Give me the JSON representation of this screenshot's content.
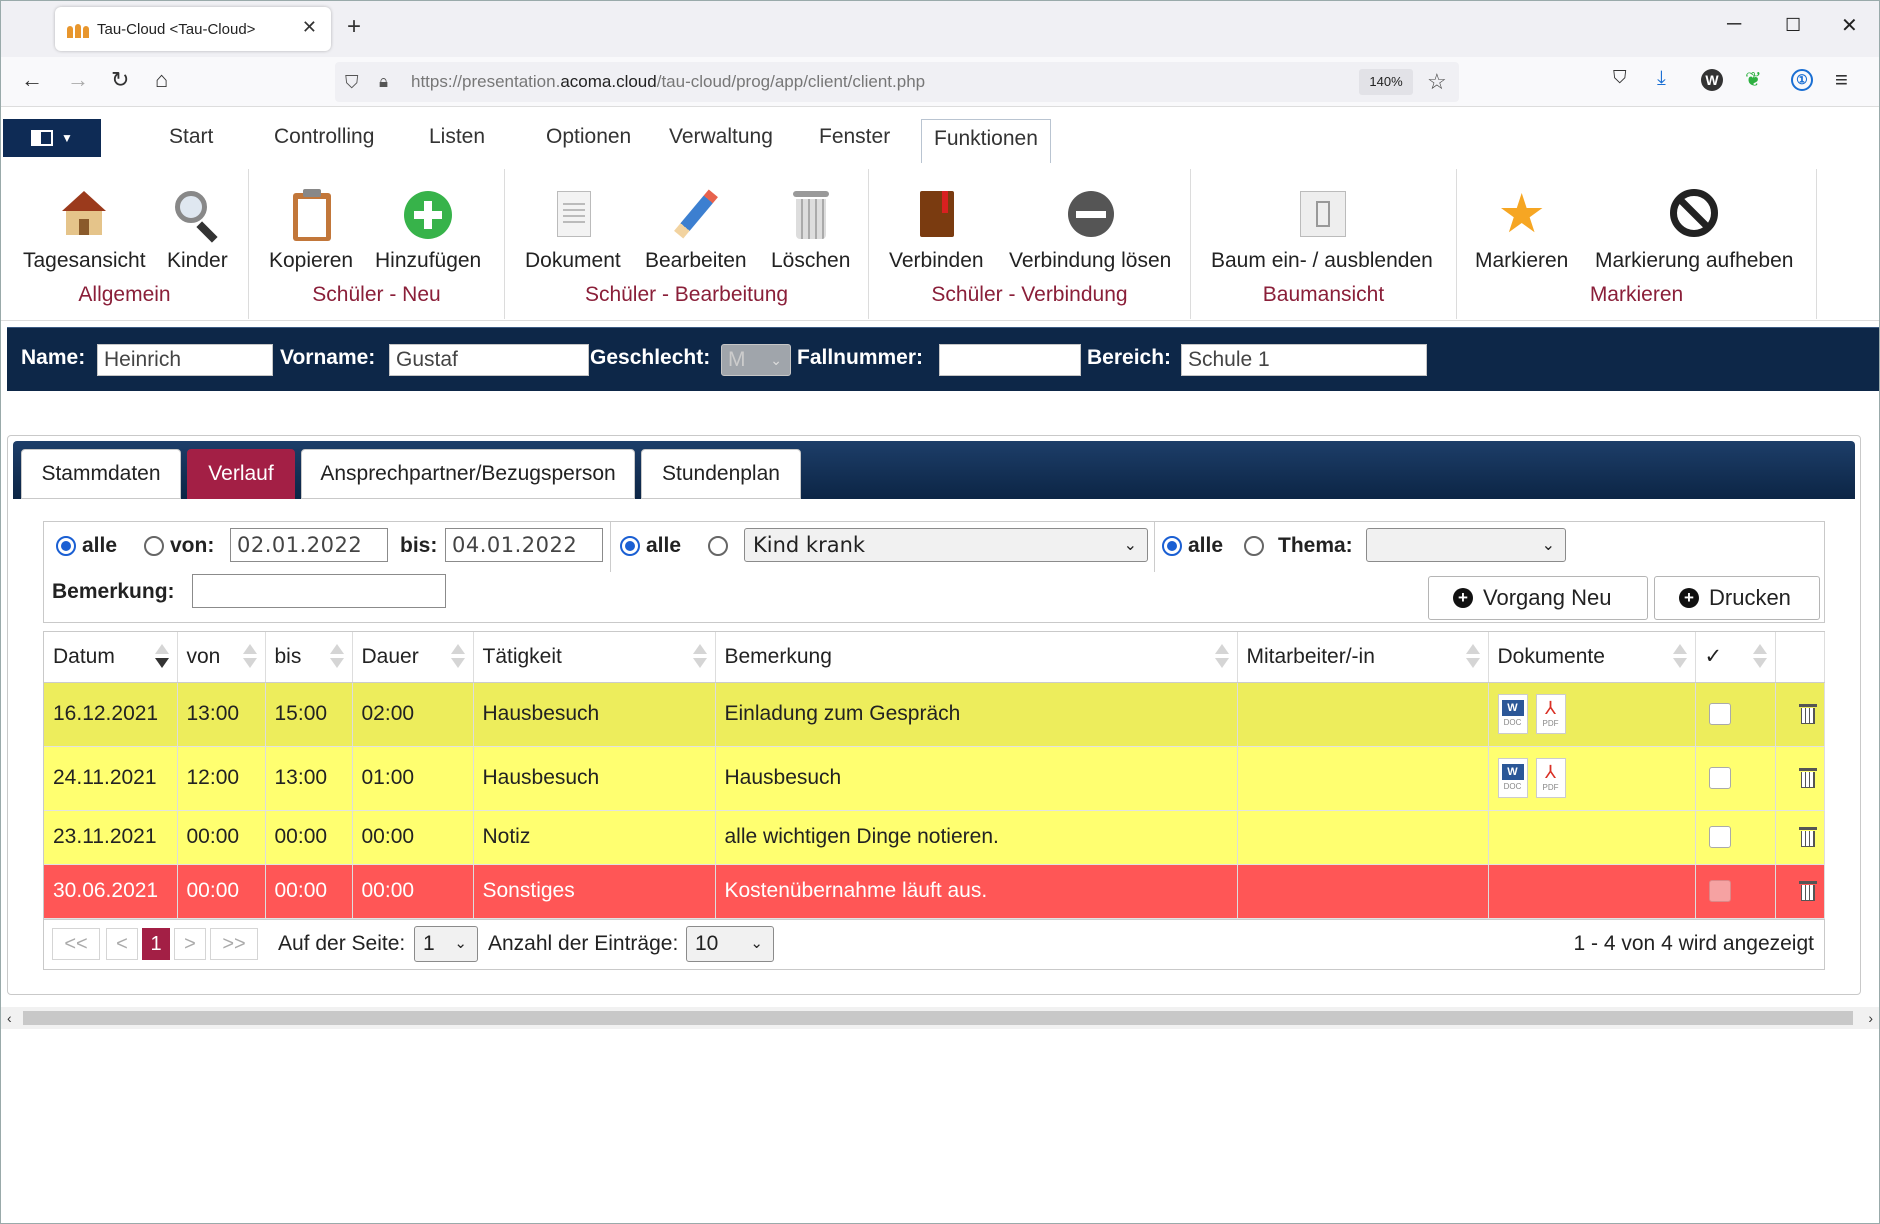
{
  "browser": {
    "tab_title": "Tau-Cloud <Tau-Cloud>",
    "url_prefix": "https://presentation.",
    "url_domain": "acoma.cloud",
    "url_path": "/tau-cloud/prog/app/client/client.php",
    "zoom": "140%"
  },
  "menu": {
    "items": [
      "Start",
      "Controlling",
      "Listen",
      "Optionen",
      "Verwaltung",
      "Fenster",
      "Funktionen"
    ],
    "active": "Funktionen"
  },
  "ribbon": {
    "groups": [
      {
        "name": "Allgemein",
        "buttons": [
          "Tagesansicht",
          "Kinder"
        ]
      },
      {
        "name": "Schüler - Neu",
        "buttons": [
          "Kopieren",
          "Hinzufügen"
        ]
      },
      {
        "name": "Schüler - Bearbeitung",
        "buttons": [
          "Dokument",
          "Bearbeiten",
          "Löschen"
        ]
      },
      {
        "name": "Schüler - Verbindung",
        "buttons": [
          "Verbinden",
          "Verbindung lösen"
        ]
      },
      {
        "name": "Baumansicht",
        "buttons": [
          "Baum ein- / ausblenden"
        ]
      },
      {
        "name": "Markieren",
        "buttons": [
          "Markieren",
          "Markierung aufheben"
        ]
      }
    ]
  },
  "header": {
    "name_label": "Name:",
    "name_value": "Heinrich",
    "vorname_label": "Vorname:",
    "vorname_value": "Gustaf",
    "geschlecht_label": "Geschlecht:",
    "geschlecht_value": "M",
    "fallnummer_label": "Fallnummer:",
    "fallnummer_value": "",
    "bereich_label": "Bereich:",
    "bereich_value": "Schule 1"
  },
  "tabs": [
    "Stammdaten",
    "Verlauf",
    "Ansprechpartner/Bezugsperson",
    "Stundenplan"
  ],
  "active_tab": "Verlauf",
  "filter": {
    "alle": "alle",
    "von_label": "von:",
    "von_value": "02.01.2022",
    "bis_label": "bis:",
    "bis_value": "04.01.2022",
    "taetigkeit_value": "Kind krank",
    "thema_label": "Thema:",
    "thema_value": "",
    "bemerkung_label": "Bemerkung:",
    "bemerkung_value": "",
    "btn_vorgang_neu": "Vorgang Neu",
    "btn_drucken": "Drucken"
  },
  "table": {
    "columns": [
      "Datum",
      "von",
      "bis",
      "Dauer",
      "Tätigkeit",
      "Bemerkung",
      "Mitarbeiter/-in",
      "Dokumente",
      "✓"
    ],
    "rows": [
      {
        "datum": "16.12.2021",
        "von": "13:00",
        "bis": "15:00",
        "dauer": "02:00",
        "taetigkeit": "Hausbesuch",
        "bemerkung": "Einladung zum Gespräch",
        "mitarbeiter": "",
        "docs": true
      },
      {
        "datum": "24.11.2021",
        "von": "12:00",
        "bis": "13:00",
        "dauer": "01:00",
        "taetigkeit": "Hausbesuch",
        "bemerkung": "Hausbesuch",
        "mitarbeiter": "",
        "docs": true
      },
      {
        "datum": "23.11.2021",
        "von": "00:00",
        "bis": "00:00",
        "dauer": "00:00",
        "taetigkeit": "Notiz",
        "bemerkung": "alle wichtigen Dinge notieren.",
        "mitarbeiter": "",
        "docs": false
      },
      {
        "datum": "30.06.2021",
        "von": "00:00",
        "bis": "00:00",
        "dauer": "00:00",
        "taetigkeit": "Sonstiges",
        "bemerkung": "Kostenübernahme läuft aus.",
        "mitarbeiter": "",
        "docs": false
      }
    ],
    "row_colors": [
      "#eded5c",
      "#ffff70",
      "#ffff70",
      "#ff5656"
    ]
  },
  "pager": {
    "first": "<<",
    "prev": "<",
    "current": "1",
    "next": ">",
    "last": ">>",
    "page_label": "Auf der Seite:",
    "page_value": "1",
    "count_label": "Anzahl der Einträge:",
    "count_value": "10",
    "summary": "1 - 4 von 4 wird angezeigt"
  },
  "colors": {
    "accent": "#a31f45",
    "navy": "#0d2748",
    "group_label": "#8a1f39"
  }
}
